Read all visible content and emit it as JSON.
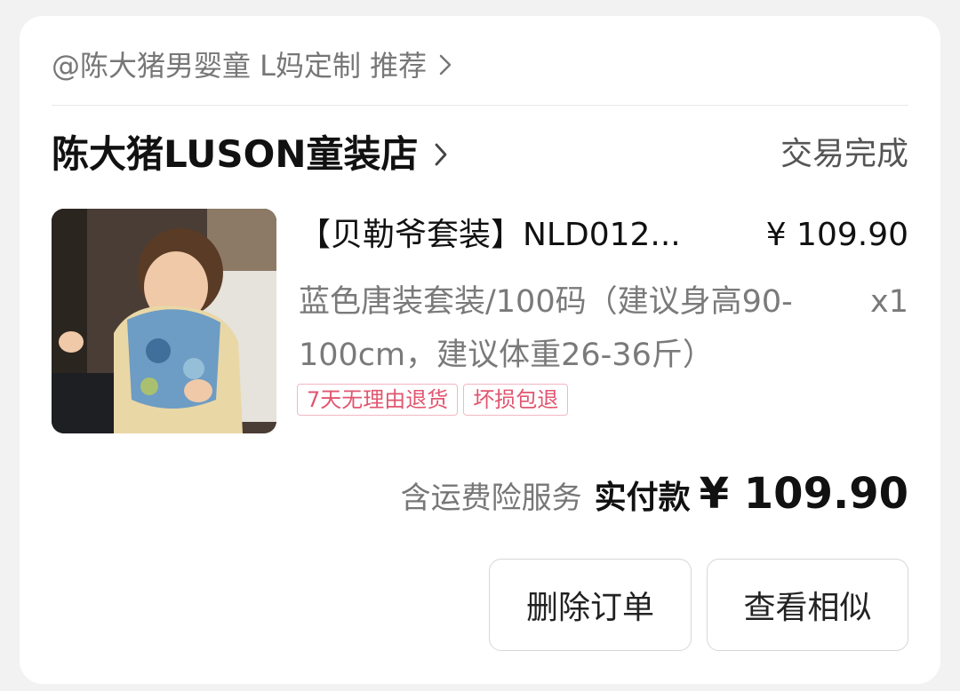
{
  "recommend": {
    "text": "@陈大猪男婴童 L妈定制 推荐",
    "chevron_icon": "chevron-right-icon"
  },
  "shop": {
    "name": "陈大猪LUSON童装店",
    "chevron_icon": "chevron-right-icon",
    "status": "交易完成"
  },
  "product": {
    "image_icon": "product-photo",
    "title": "【贝勒爷套装】NLD012...",
    "price": "¥ 109.90",
    "spec": "蓝色唐装套装/100码（建议身高90-100cm，建议体重26-36斤）",
    "quantity": "x1",
    "tags": [
      "7天无理由退货",
      "坏损包退"
    ]
  },
  "total": {
    "shipping_note": "含运费险服务",
    "paid_label": "实付款",
    "paid_amount": "¥ 109.90"
  },
  "actions": {
    "delete_label": "删除订单",
    "similar_label": "查看相似"
  },
  "colors": {
    "background": "#f2f2f2",
    "card": "#ffffff",
    "tag_text": "#e0566f",
    "tag_border": "#f2b8c2"
  }
}
